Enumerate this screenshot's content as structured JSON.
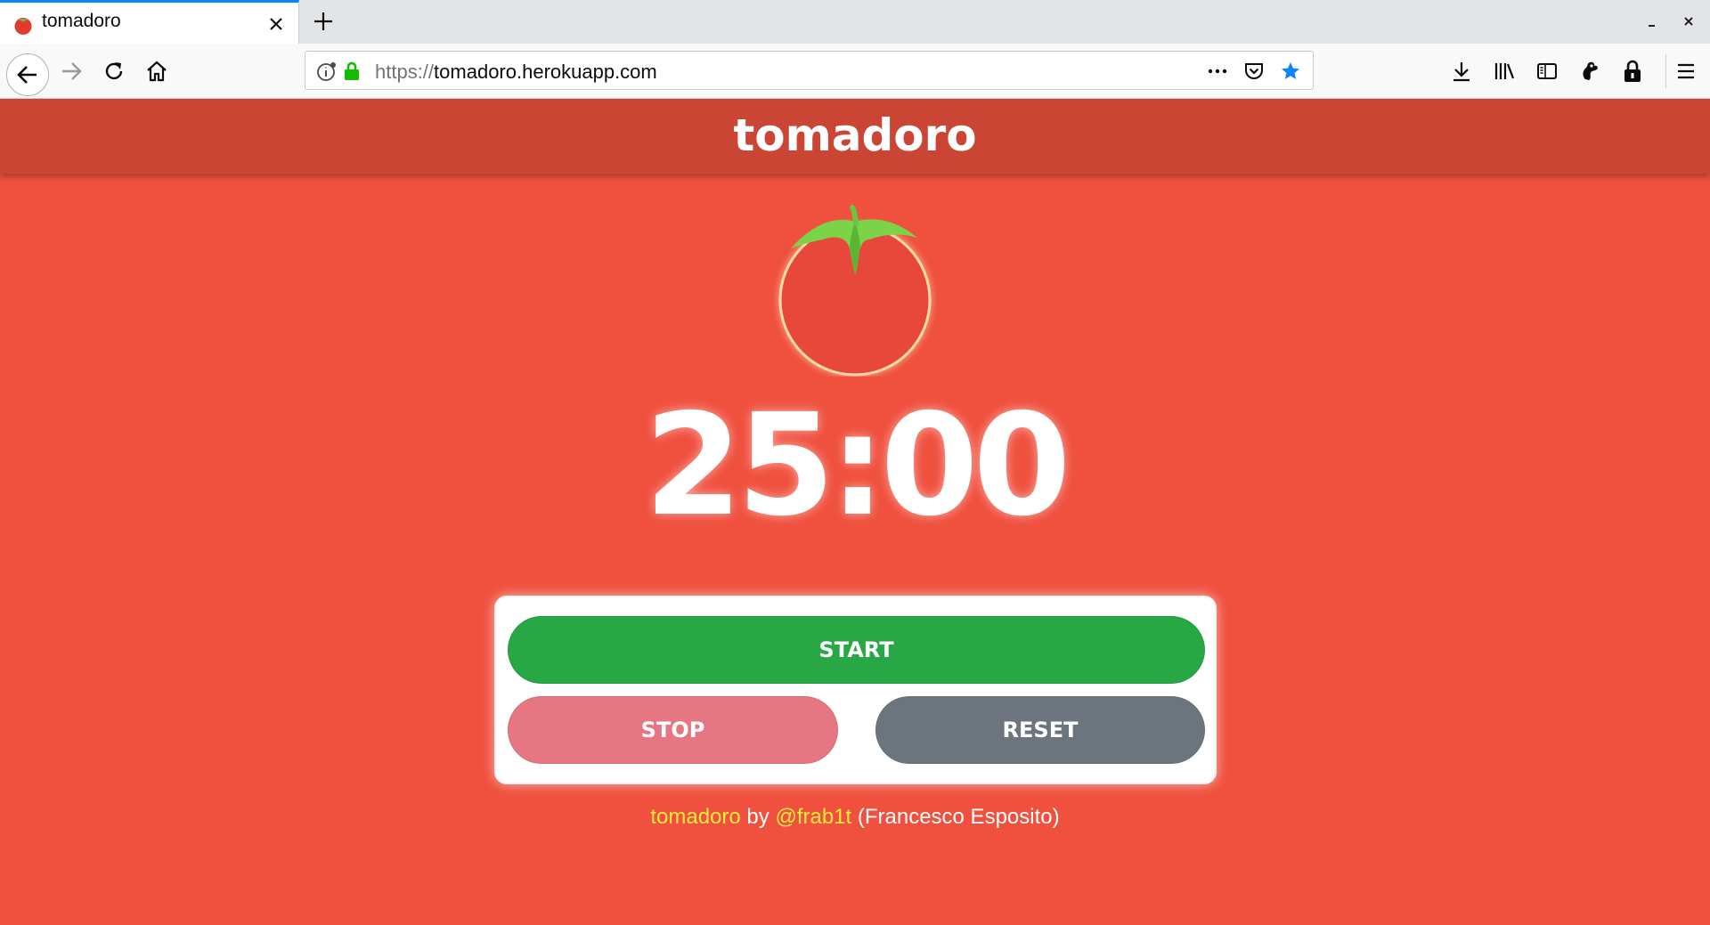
{
  "browser": {
    "tab_title": "tomadoro",
    "url_scheme": "https://",
    "url_host": "tomadoro.herokuapp.com"
  },
  "page": {
    "brand": "tomadoro",
    "timer": "25:00",
    "buttons": {
      "start": "START",
      "stop": "STOP",
      "reset": "RESET"
    },
    "footer": {
      "app_name": "tomadoro",
      "by": " by ",
      "handle": "@frab1t",
      "author": " (Francesco Esposito)"
    }
  },
  "colors": {
    "page_bg": "#f0503e",
    "header_bg": "#cb4534",
    "start": "#28a745",
    "stop": "#e67782",
    "reset": "#6c757d",
    "footer_link": "#ffeb3b",
    "bookmark_star": "#0a84ff"
  },
  "icons": [
    "tomato-favicon-icon",
    "close-icon",
    "plus-icon",
    "minimize-icon",
    "back-arrow-icon",
    "forward-arrow-icon",
    "reload-icon",
    "home-icon",
    "info-icon",
    "lock-icon",
    "more-icon",
    "pocket-icon",
    "bookmark-star-icon",
    "download-icon",
    "library-icon",
    "sidebar-icon",
    "extension-icon",
    "padlock-icon",
    "menu-icon",
    "tomato-icon"
  ]
}
